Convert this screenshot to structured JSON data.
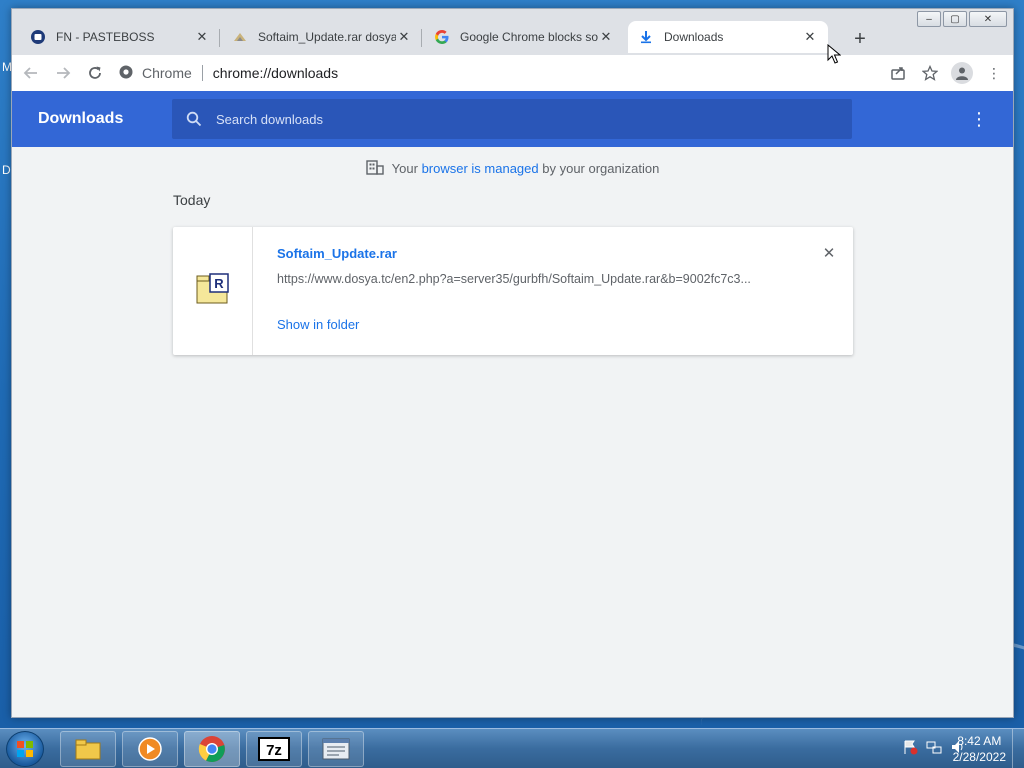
{
  "desktop": {
    "left_letters": [
      "M",
      "D"
    ]
  },
  "window_controls": {
    "minimize": "‒",
    "maximize": "▢",
    "close": "✕"
  },
  "tabs": [
    {
      "title": "FN - PASTEBOSS",
      "icon": "pasteboss-icon"
    },
    {
      "title": "Softaim_Update.rar dosya",
      "icon": "dosya-icon"
    },
    {
      "title": "Google Chrome blocks so",
      "icon": "google-icon"
    },
    {
      "title": "Downloads",
      "icon": "download-icon",
      "active": true
    }
  ],
  "toolbar": {
    "site_label": "Chrome",
    "url": "chrome://downloads"
  },
  "downloads": {
    "title": "Downloads",
    "search_placeholder": "Search downloads",
    "managed_prefix": "Your",
    "managed_link": "browser is managed",
    "managed_suffix": "by your organization",
    "date_heading": "Today",
    "items": [
      {
        "filename": "Softaim_Update.rar",
        "url": "https://www.dosya.tc/en2.php?a=server35/gurbfh/Softaim_Update.rar&b=9002fc7c3...",
        "action": "Show in folder",
        "file_icon": "rar-archive-icon"
      }
    ]
  },
  "taskbar": {
    "time": "8:42 AM",
    "date": "2/28/2022",
    "pinned": [
      "file-explorer-icon",
      "media-player-icon",
      "chrome-icon",
      "7zip-icon",
      "notepad-window-icon"
    ]
  },
  "colors": {
    "header_blue": "#3367d6",
    "link_blue": "#1a73e8"
  }
}
